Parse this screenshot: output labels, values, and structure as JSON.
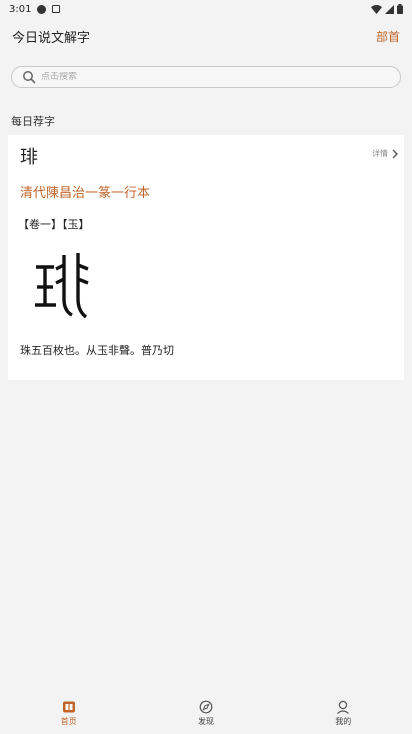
{
  "status_bar": {
    "time": "3:01"
  },
  "header": {
    "title": "今日说文解字",
    "action": "部首"
  },
  "search": {
    "placeholder": "点击搜索"
  },
  "section": {
    "label": "每日荐字"
  },
  "card": {
    "character": "琲",
    "detail_label": "详情",
    "source_title": "清代陳昌治一篆一行本",
    "volume_tags": "【卷一】【玉】",
    "definition": "珠五百枚也。从玉非聲。普乃切"
  },
  "bottom_nav": {
    "items": [
      {
        "label": "首页",
        "icon": "book-icon",
        "active": true
      },
      {
        "label": "发现",
        "icon": "compass-icon",
        "active": false
      },
      {
        "label": "我的",
        "icon": "user-icon",
        "active": false
      }
    ]
  },
  "colors": {
    "accent": "#c0652a",
    "background": "#f3f3f3",
    "card": "#ffffff"
  }
}
